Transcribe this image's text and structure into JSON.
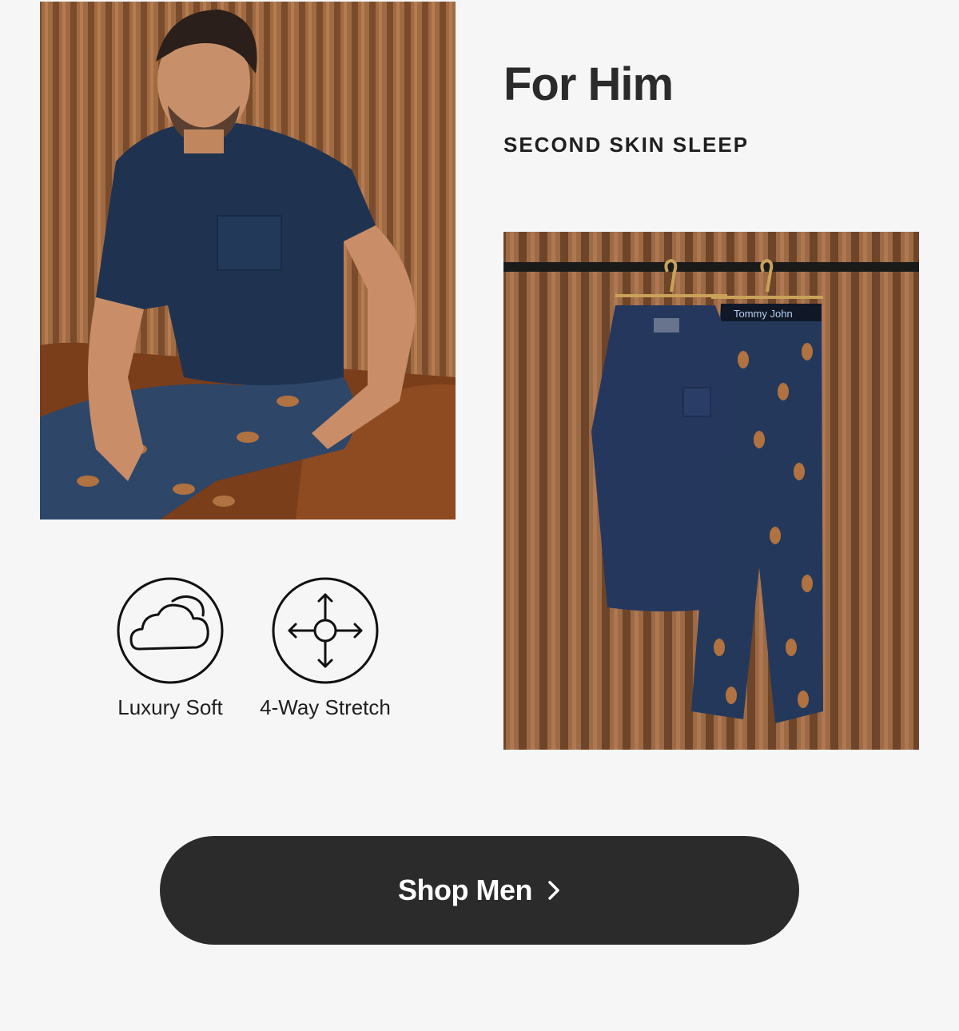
{
  "headline": "For Him",
  "subheadline": "SECOND SKIN SLEEP",
  "images": {
    "model_photo": "man in navy pocket tee and football print sleep pants",
    "hanging_photo": "navy tee and football print pants on hangers",
    "waistband_text": "Tommy John"
  },
  "features": [
    {
      "icon": "cloud-icon",
      "label": "Luxury Soft"
    },
    {
      "icon": "four-way-arrows-icon",
      "label": "4-Way Stretch"
    }
  ],
  "cta": {
    "label": "Shop Men",
    "icon": "chevron-right-icon"
  },
  "colors": {
    "background": "#f6f6f6",
    "button": "#2b2b2b",
    "button_text": "#ffffff",
    "navy": "#22334f",
    "wood": "#8a5a38"
  }
}
